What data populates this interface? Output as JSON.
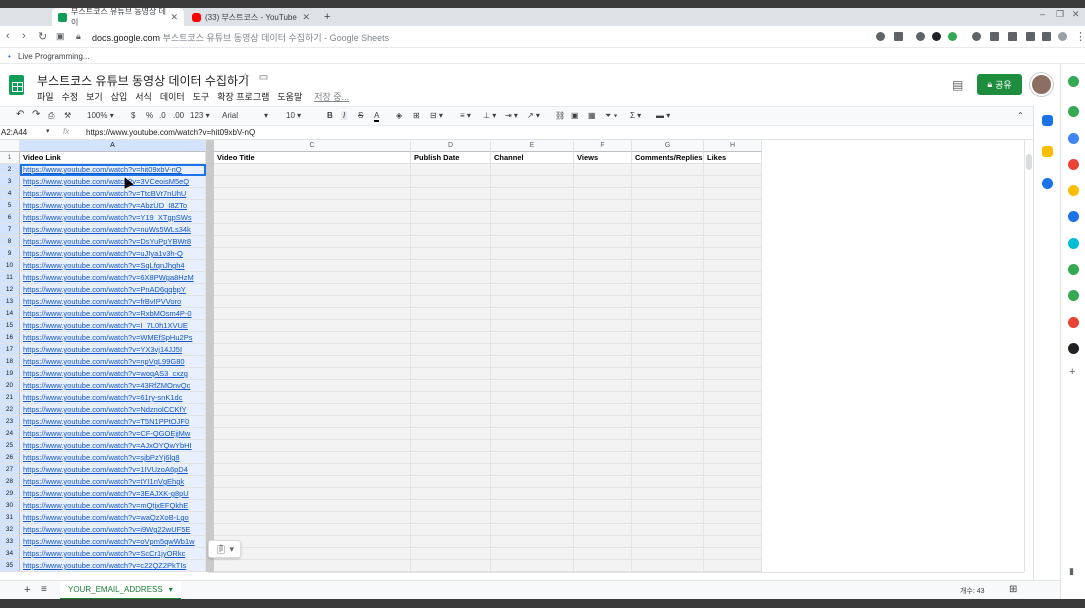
{
  "browser": {
    "tabs": [
      {
        "label": "부스트코스 유튜브 동영상 데이",
        "active": true
      },
      {
        "label": "(33) 부스트코스 - YouTube",
        "active": false
      }
    ],
    "new_tab": "+",
    "url_host": "docs.google.com",
    "url_rest": "부스트코스 유튜브 동영상 데이터 수집하기 - Google Sheets",
    "bookmark": "Live Programming..."
  },
  "doc": {
    "title": "부스트코스 유튜브 동영상 데이터 수집하기",
    "menu": [
      "파일",
      "수정",
      "보기",
      "삽입",
      "서식",
      "데이터",
      "도구",
      "확장 프로그램",
      "도움말"
    ],
    "saved": "저장 중...",
    "share_label": "공유"
  },
  "toolbar": {
    "zoom": "100%",
    "currency": "$",
    "percent": "%",
    "dec_less": ".0",
    "dec_more": ".00",
    "num_format": "123",
    "font": "Arial",
    "font_size": "10",
    "bold": "B",
    "italic": "I",
    "strike": "S",
    "text_color": "A"
  },
  "formula": {
    "namebox": "A2:A44",
    "fx": "fx",
    "content": "https://www.youtube.com/watch?v=hit09xbV-nQ"
  },
  "sheet": {
    "columns": [
      "A",
      "B",
      "C",
      "D",
      "E",
      "F",
      "G",
      "H"
    ],
    "headers": [
      "Video Link",
      "",
      "Video Title",
      "Publish Date",
      "Channel",
      "Views",
      "Comments/Replies",
      "Likes"
    ],
    "rows": [
      "1",
      "2",
      "3",
      "4",
      "5",
      "6",
      "7",
      "8",
      "9",
      "10",
      "11",
      "12",
      "13",
      "14",
      "15",
      "16",
      "17",
      "18",
      "19",
      "20",
      "21",
      "22",
      "23",
      "24",
      "25",
      "26",
      "27",
      "28",
      "29",
      "30",
      "31",
      "32",
      "33",
      "34",
      "35"
    ],
    "links": [
      "https://www.youtube.com/watch?v=hit09xbV-nQ",
      "https://www.youtube.com/watch?v=3VCeoisM5eQ",
      "https://www.youtube.com/watch?v=TtcBVr7nUhU",
      "https://www.youtube.com/watch?v=AbzUD_I8ZTo",
      "https://www.youtube.com/watch?v=Y19_XTgpSWs",
      "https://www.youtube.com/watch?v=nuWs5WLs34k",
      "https://www.youtube.com/watch?v=DsYuPpYBWr8",
      "https://www.youtube.com/watch?v=uJIya1v3h-Q",
      "https://www.youtube.com/watch?v=SqLfqnJhgh4",
      "https://www.youtube.com/watch?v=6X8PWga8HzM",
      "https://www.youtube.com/watch?v=PnAD6gqbpY",
      "https://www.youtube.com/watch?v=frBvIPVVoro",
      "https://www.youtube.com/watch?v=RxbMOsm4P-0",
      "https://www.youtube.com/watch?v=I_7L0h1XVUE",
      "https://www.youtube.com/watch?v=WMEfSpHu2Ps",
      "https://www.youtube.com/watch?v=YX3vj14JJ5I",
      "https://www.youtube.com/watch?v=npVqL99G80",
      "https://www.youtube.com/watch?v=woqAS3_cxzg",
      "https://www.youtube.com/watch?v=43RfZMOnvQc",
      "https://www.youtube.com/watch?v=61ry-snK1dc",
      "https://www.youtube.com/watch?v=NdznolCCKfY",
      "https://www.youtube.com/watch?v=T5N1PPtOJF0",
      "https://www.youtube.com/watch?v=CF-QGOEjjMw",
      "https://www.youtube.com/watch?v=AJxOYQwYbHI",
      "https://www.youtube.com/watch?v=sjbPzYj6lg8",
      "https://www.youtube.com/watch?v=1IVUzoA6pD4",
      "https://www.youtube.com/watch?v=tYI1nVgEhgk",
      "https://www.youtube.com/watch?v=3EAJXK-g8pU",
      "https://www.youtube.com/watch?v=mQtjxEFQkhE",
      "https://www.youtube.com/watch?v=waQzXoB-Lgo",
      "https://www.youtube.com/watch?v=i9Wg22wUF5E",
      "https://www.youtube.com/watch?v=oVpm5qwWb1w",
      "https://www.youtube.com/watch?v=ScCr1jyORkc",
      "https://www.youtube.com/watch?v=c22QZ2PkTIs"
    ],
    "tab_name": "YOUR_EMAIL_ADDRESS",
    "count_label": "개수: 43"
  },
  "colors": {
    "accent": "#1a73e8",
    "share": "#1e8e3e",
    "link": "#1155cc",
    "selection": "#e8f0fe"
  }
}
